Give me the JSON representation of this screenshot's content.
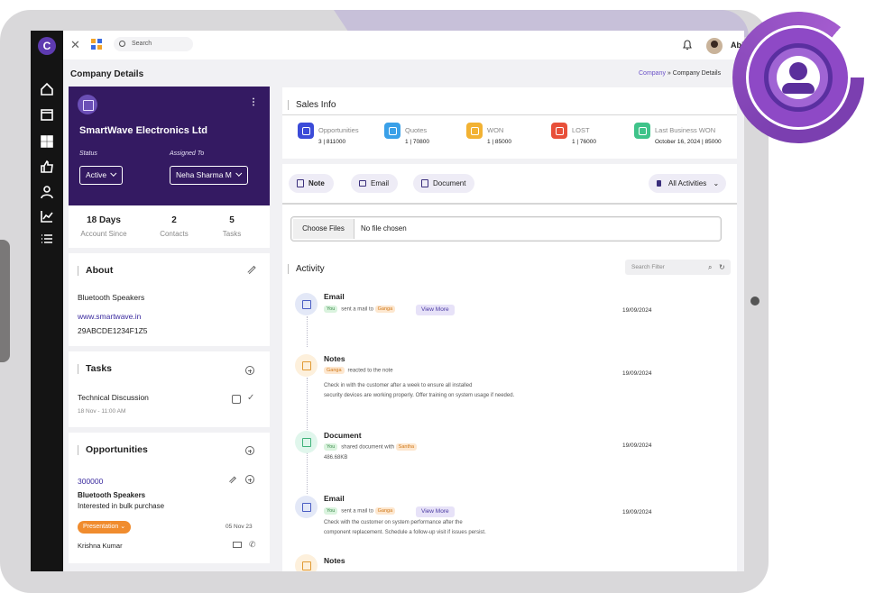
{
  "topbar": {
    "search_placeholder": "Search",
    "user_name": "Abilash"
  },
  "header": {
    "title": "Company Details",
    "breadcrumb_root": "Company",
    "breadcrumb_sep": "»",
    "breadcrumb_current": "Company Details"
  },
  "company": {
    "name": "SmartWave Electronics Ltd",
    "status_label": "Status",
    "status_value": "Active",
    "assigned_label": "Assigned To",
    "assigned_value": "Neha Sharma M"
  },
  "stats": [
    {
      "value": "18 Days",
      "label": "Account Since"
    },
    {
      "value": "2",
      "label": "Contacts"
    },
    {
      "value": "5",
      "label": "Tasks"
    }
  ],
  "about": {
    "title": "About",
    "line1": "Bluetooth Speakers",
    "website": "www.smartwave.in",
    "code": "29ABCDE1234F1Z5"
  },
  "tasks": {
    "title": "Tasks",
    "item_title": "Technical Discussion",
    "item_time": "18 Nov - 11:00 AM"
  },
  "opportunities": {
    "title": "Opportunities",
    "amount": "300000",
    "product": "Bluetooth Speakers",
    "note": "Interested in bulk purchase",
    "stage": "Presentation",
    "date": "05 Nov 23",
    "owner": "Krishna Kumar"
  },
  "sales": {
    "title": "Sales Info",
    "kpis": [
      {
        "label": "Opportunities",
        "value": "3 | 811000",
        "color": "#3b4bd8"
      },
      {
        "label": "Quotes",
        "value": "1 | 70800",
        "color": "#3aa0e8"
      },
      {
        "label": "WON",
        "value": "1 | 85000",
        "color": "#f2b233"
      },
      {
        "label": "LOST",
        "value": "1 | 76000",
        "color": "#e8503a"
      },
      {
        "label": "Last Business WON",
        "value": "October 16, 2024 | 85000",
        "color": "#3fc38a"
      }
    ]
  },
  "actions": {
    "note": "Note",
    "email": "Email",
    "document": "Document",
    "filter": "All Activities"
  },
  "upload": {
    "button": "Choose Files",
    "status": "No file chosen"
  },
  "activity": {
    "title": "Activity",
    "filter_placeholder": "Search Filter",
    "items": [
      {
        "title": "Email",
        "chip1": "You",
        "mid": "sent a mail to",
        "chip2": "Ganga",
        "view_more": "View More",
        "date": "19/09/2024"
      },
      {
        "title": "Notes",
        "chip1": "Ganga",
        "mid": "reacted to the note",
        "body1": "Check in with the customer after a week to ensure all installed",
        "body2": "security devices are working properly. Offer training on system usage if needed.",
        "date": "19/09/2024"
      },
      {
        "title": "Document",
        "chip1": "You",
        "mid": "shared document with",
        "chip2": "Santha",
        "body1": "486.68KB",
        "date": "19/09/2024"
      },
      {
        "title": "Email",
        "chip1": "You",
        "mid": "sent a mail to",
        "chip2": "Ganga",
        "view_more": "View More",
        "body1": "Check with the customer on system performance after the",
        "body2": "component replacement. Schedule a follow-up visit if issues persist.",
        "date": "19/09/2024"
      },
      {
        "title": "Notes"
      }
    ]
  }
}
